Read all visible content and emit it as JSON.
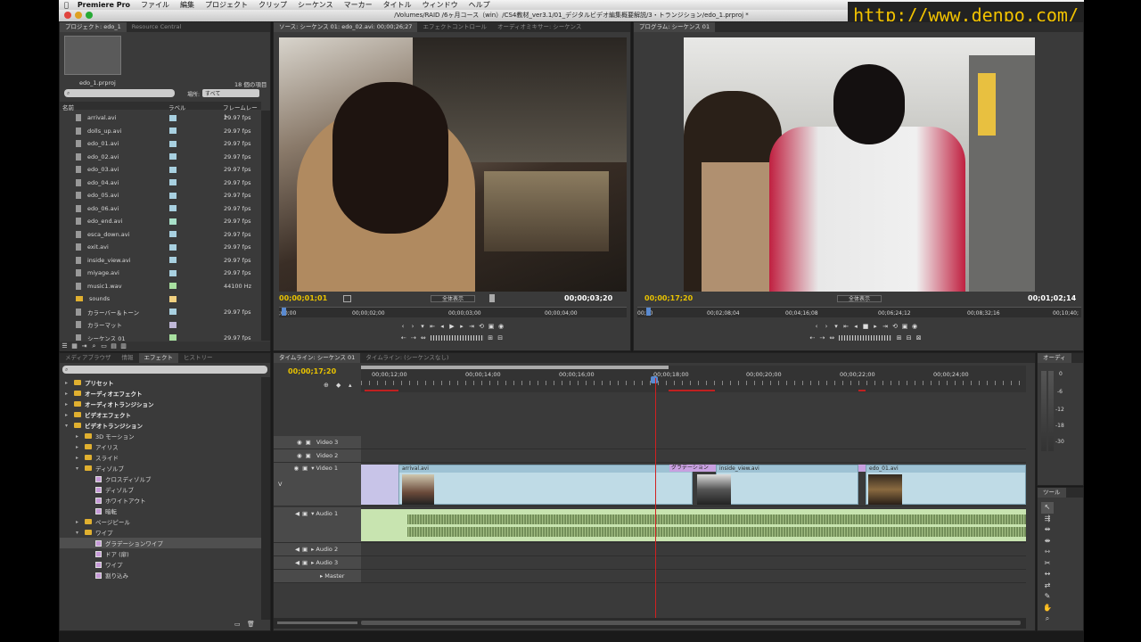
{
  "menubar": {
    "app_name": "Premiere Pro",
    "items": [
      "ファイル",
      "編集",
      "プロジェクト",
      "クリップ",
      "シーケンス",
      "マーカー",
      "タイトル",
      "ウィンドウ",
      "ヘルプ"
    ]
  },
  "window_title": "/Volumes/RAID /6ヶ月コース（win）/CS4教材_ver3.1/01_デジタルビデオ編集概要解説/3・トランジション/edo_1.prproj *",
  "watermark_url": "http://www.denpo.com/",
  "project_panel": {
    "tabs": [
      "プロジェクト: edo_1",
      "Resource Central"
    ],
    "project_file": "edo_1.prproj",
    "item_count": "18 個の項目",
    "location_label": "場所:",
    "location_value": "すべて",
    "columns": [
      "名前",
      "ラベル",
      "フレームレート"
    ],
    "items": [
      {
        "name": "arrival.avi",
        "fps": "29.97 fps",
        "label": "#a8d0e0"
      },
      {
        "name": "dolls_up.avi",
        "fps": "29.97 fps",
        "label": "#a8d0e0"
      },
      {
        "name": "edo_01.avi",
        "fps": "29.97 fps",
        "label": "#a8d0e0"
      },
      {
        "name": "edo_02.avi",
        "fps": "29.97 fps",
        "label": "#a8d0e0"
      },
      {
        "name": "edo_03.avi",
        "fps": "29.97 fps",
        "label": "#a8d0e0"
      },
      {
        "name": "edo_04.avi",
        "fps": "29.97 fps",
        "label": "#a8d0e0"
      },
      {
        "name": "edo_05.avi",
        "fps": "29.97 fps",
        "label": "#a8d0e0"
      },
      {
        "name": "edo_06.avi",
        "fps": "29.97 fps",
        "label": "#a8d0e0"
      },
      {
        "name": "edo_end.avi",
        "fps": "29.97 fps",
        "label": "#a8e0c8"
      },
      {
        "name": "esca_down.avi",
        "fps": "29.97 fps",
        "label": "#a8d0e0"
      },
      {
        "name": "exit.avi",
        "fps": "29.97 fps",
        "label": "#a8d0e0"
      },
      {
        "name": "inside_view.avi",
        "fps": "29.97 fps",
        "label": "#a8d0e0"
      },
      {
        "name": "miyage.avi",
        "fps": "29.97 fps",
        "label": "#a8d0e0"
      },
      {
        "name": "music1.wav",
        "fps": "44100 Hz",
        "label": "#a8e0a0"
      },
      {
        "name": "sounds",
        "fps": "",
        "label": "#f0d080"
      },
      {
        "name": "カラーバー＆トーン",
        "fps": "29.97 fps",
        "label": "#a8d0e0"
      },
      {
        "name": "カラーマット",
        "fps": "",
        "label": "#c0b8d8"
      },
      {
        "name": "シーケンス 01",
        "fps": "29.97 fps",
        "label": "#a8e0a0"
      }
    ]
  },
  "source_monitor": {
    "tabs": [
      "ソース: シーケンス 01: edo_02.avi: 00;00;26;27",
      "エフェクトコントロール",
      "オーディオミキサー: シーケンス"
    ],
    "current_time": "00;00;01;01",
    "duration": "00;00;03;20",
    "fit": "全体表示",
    "ruler": [
      ";00;00",
      "00;00;02;00",
      "00;00;03;00",
      "00;00;04;00"
    ]
  },
  "program_monitor": {
    "tabs": [
      "プログラム: シーケンス 01"
    ],
    "current_time": "00;00;17;20",
    "duration": "00;01;02;14",
    "fit": "全体表示",
    "ruler": [
      "00;00",
      "00;02;08;04",
      "00;04;16;08",
      "00;06;24;12",
      "00;08;32;16",
      "00;10;40;"
    ]
  },
  "effects_panel": {
    "tabs": [
      "メディアブラウザ",
      "情報",
      "エフェクト",
      "ヒストリー"
    ],
    "tree": [
      {
        "label": "プリセット",
        "level": 0,
        "bold": true,
        "kind": "folder"
      },
      {
        "label": "オーディオエフェクト",
        "level": 0,
        "bold": true,
        "kind": "folder"
      },
      {
        "label": "オーディオトランジション",
        "level": 0,
        "bold": true,
        "kind": "folder"
      },
      {
        "label": "ビデオエフェクト",
        "level": 0,
        "bold": true,
        "kind": "folder"
      },
      {
        "label": "ビデオトランジション",
        "level": 0,
        "bold": true,
        "kind": "folder",
        "open": true
      },
      {
        "label": "3D モーション",
        "level": 1,
        "kind": "folder"
      },
      {
        "label": "アイリス",
        "level": 1,
        "kind": "folder"
      },
      {
        "label": "スライド",
        "level": 1,
        "kind": "folder"
      },
      {
        "label": "ディゾルブ",
        "level": 1,
        "kind": "folder",
        "open": true
      },
      {
        "label": "クロスディゾルブ",
        "level": 2,
        "kind": "fx"
      },
      {
        "label": "ディゾルブ",
        "level": 2,
        "kind": "fx"
      },
      {
        "label": "ホワイトアウト",
        "level": 2,
        "kind": "fx"
      },
      {
        "label": "暗転",
        "level": 2,
        "kind": "fx"
      },
      {
        "label": "ページピール",
        "level": 1,
        "kind": "folder"
      },
      {
        "label": "ワイプ",
        "level": 1,
        "kind": "folder",
        "open": true
      },
      {
        "label": "グラデーションワイプ",
        "level": 2,
        "kind": "fx",
        "selected": true
      },
      {
        "label": "ドア (扉)",
        "level": 2,
        "kind": "fx"
      },
      {
        "label": "ワイプ",
        "level": 2,
        "kind": "fx"
      },
      {
        "label": "割り込み",
        "level": 2,
        "kind": "fx"
      }
    ]
  },
  "timeline": {
    "tabs": [
      "タイムライン: シーケンス 01",
      "タイムライン: (シーケンスなし)"
    ],
    "current_time": "00;00;17;20",
    "ruler": [
      "00;00;12;00",
      "00;00;14;00",
      "00;00;16;00",
      "00;00;18;00",
      "00;00;20;00",
      "00;00;22;00",
      "00;00;24;00"
    ],
    "tracks": [
      "Video 3",
      "Video 2",
      "Video 1",
      "Audio 1",
      "Audio 2",
      "Audio 3",
      "Master"
    ],
    "track_v_label": "V",
    "track_a_label": "A",
    "clips": [
      "arrival.avi",
      "inside_view.avi",
      "edo_01.avi"
    ],
    "transition_label": "グラデーション"
  },
  "audio_meter": {
    "title": "オーディ",
    "levels": [
      "0",
      "-6",
      "-12",
      "-18",
      "-30"
    ]
  },
  "tools_panel": {
    "title": "ツール"
  },
  "colors": {
    "accent": "#f2b400",
    "timecode": "#e8c200",
    "playhead": "#d02020"
  }
}
